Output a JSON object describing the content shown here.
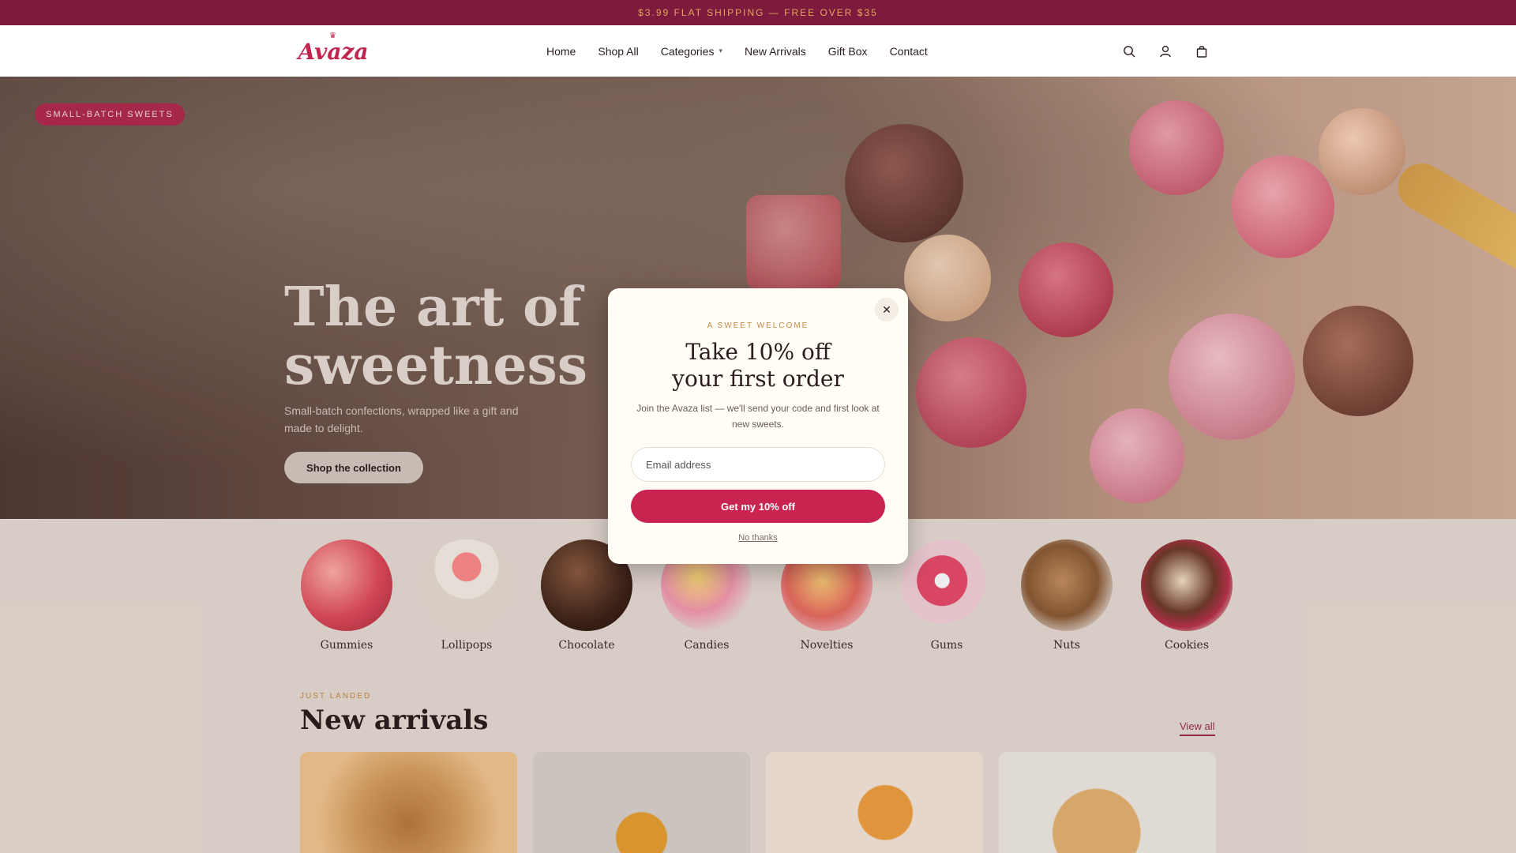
{
  "announcement": {
    "text": "$3.99 FLAT SHIPPING — FREE OVER $35"
  },
  "header": {
    "logo_text": "Avaza",
    "nav": [
      {
        "label": "Home"
      },
      {
        "label": "Shop All"
      },
      {
        "label": "Categories",
        "has_dropdown": true
      },
      {
        "label": "New Arrivals"
      },
      {
        "label": "Gift Box"
      },
      {
        "label": "Contact"
      }
    ],
    "icons": [
      "search-icon",
      "account-icon",
      "cart-icon"
    ]
  },
  "hero": {
    "badge": "SMALL-BATCH SWEETS",
    "title": "The art of sweetness",
    "subtitle": "Small-batch confections, wrapped like a gift and made to delight.",
    "cta": "Shop the collection"
  },
  "categories": [
    {
      "label": "Gummies"
    },
    {
      "label": "Lollipops"
    },
    {
      "label": "Chocolate"
    },
    {
      "label": "Candies"
    },
    {
      "label": "Novelties"
    },
    {
      "label": "Gums"
    },
    {
      "label": "Nuts"
    },
    {
      "label": "Cookies"
    }
  ],
  "new_arrivals": {
    "eyebrow": "JUST LANDED",
    "title": "New arrivals",
    "view_all": "View all"
  },
  "modal": {
    "eyebrow": "A SWEET WELCOME",
    "title_line1": "Take 10% off",
    "title_line2": "your first order",
    "description": "Join the Avaza list — we'll send your code and first look at new sweets.",
    "email_placeholder": "Email address",
    "submit": "Get my 10% off",
    "dismiss": "No thanks"
  },
  "colors": {
    "brand": "#c9234f",
    "announcement_bg": "#7e1a3e",
    "accent_gold": "#c48a45"
  }
}
